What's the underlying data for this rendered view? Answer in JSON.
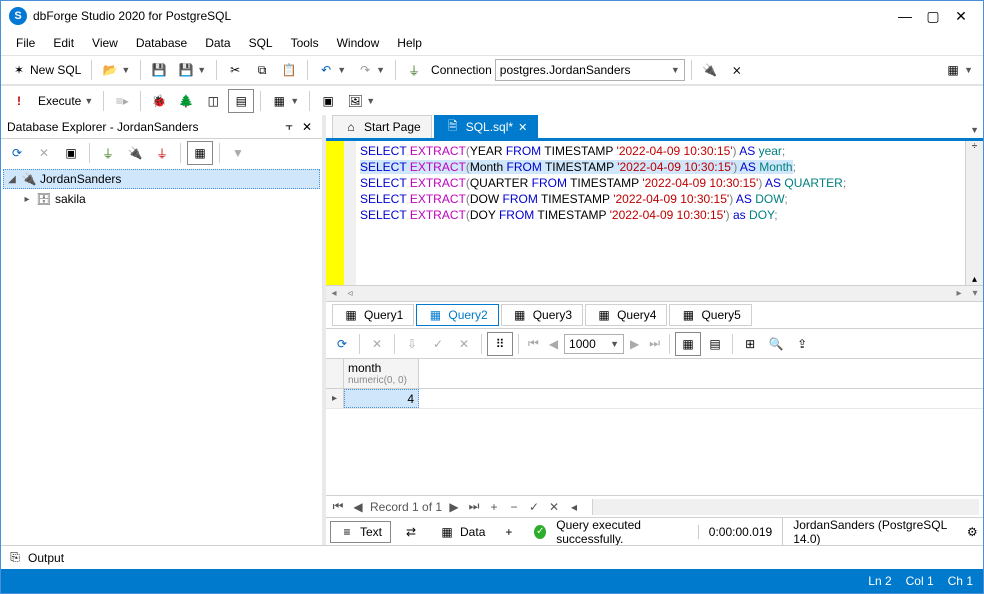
{
  "window": {
    "title": "dbForge Studio 2020 for PostgreSQL"
  },
  "menu": {
    "items": [
      "File",
      "Edit",
      "View",
      "Database",
      "Data",
      "SQL",
      "Tools",
      "Window",
      "Help"
    ]
  },
  "toolbar1": {
    "newsql": "New SQL",
    "connection_label": "Connection",
    "connection_value": "postgres.JordanSanders"
  },
  "exec_toolbar": {
    "execute": "Execute"
  },
  "db_explorer": {
    "title": "Database Explorer - JordanSanders",
    "root": "JordanSanders",
    "child": "sakila"
  },
  "doc_tabs": {
    "start": "Start Page",
    "sql": "SQL.sql*"
  },
  "code_lines": [
    {
      "select": "SELECT",
      "extract": "EXTRACT",
      "part": "YEAR",
      "from": "FROM",
      "ts": "TIMESTAMP",
      "lit": "'2022-04-09 10:30:15'",
      "as": "AS",
      "alias": "year",
      "hl": false
    },
    {
      "select": "SELECT",
      "extract": "EXTRACT",
      "part": "Month",
      "from": "FROM",
      "ts": "TIMESTAMP",
      "lit": "'2022-04-09 10:30:15'",
      "as": "AS",
      "alias": "Month",
      "hl": true
    },
    {
      "select": "SELECT",
      "extract": "EXTRACT",
      "part": "QUARTER",
      "from": "FROM",
      "ts": "TIMESTAMP",
      "lit": "'2022-04-09 10:30:15'",
      "as": "AS",
      "alias": "QUARTER",
      "hl": false
    },
    {
      "select": "SELECT",
      "extract": "EXTRACT",
      "part": "DOW",
      "from": "FROM",
      "ts": "TIMESTAMP",
      "lit": "'2022-04-09 10:30:15'",
      "as": "AS",
      "alias": "DOW",
      "hl": false
    },
    {
      "select": "SELECT",
      "extract": "EXTRACT",
      "part": "DOY",
      "from": "FROM",
      "ts": "TIMESTAMP",
      "lit": "'2022-04-09 10:30:15'",
      "as": "as",
      "alias": "DOY",
      "hl": false
    }
  ],
  "query_tabs": [
    "Query1",
    "Query2",
    "Query3",
    "Query4",
    "Query5"
  ],
  "query_tabs_active_index": 1,
  "grid_toolbar": {
    "page": "1000"
  },
  "grid": {
    "column": "month",
    "column_type": "numeric(0, 0)",
    "value": "4"
  },
  "grid_footer": {
    "record": "Record 1 of 1"
  },
  "output_tabs": {
    "text": "Text",
    "data": "Data"
  },
  "status_right": {
    "msg": "Query executed successfully.",
    "time": "0:00:00.019",
    "server": "JordanSanders (PostgreSQL 14.0)"
  },
  "output_panel": {
    "label": "Output"
  },
  "statusbar": {
    "ln": "Ln 2",
    "col": "Col 1",
    "ch": "Ch 1"
  }
}
